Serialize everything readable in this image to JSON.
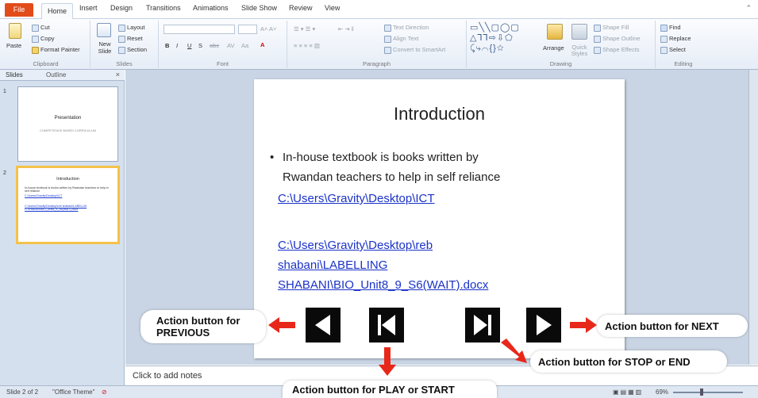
{
  "tabs": {
    "file": "File",
    "items": [
      "Home",
      "Insert",
      "Design",
      "Transitions",
      "Animations",
      "Slide Show",
      "Review",
      "View"
    ]
  },
  "ribbon": {
    "clipboard": {
      "label": "Clipboard",
      "paste": "Paste",
      "cut": "Cut",
      "copy": "Copy",
      "format_painter": "Format Painter"
    },
    "slides": {
      "label": "Slides",
      "new_slide": "New Slide",
      "layout": "Layout",
      "reset": "Reset",
      "section": "Section"
    },
    "font": {
      "label": "Font",
      "bold": "B",
      "italic": "I",
      "underline": "U",
      "strike": "S",
      "case": "Aa"
    },
    "paragraph": {
      "label": "Paragraph",
      "text_direction": "Text Direction",
      "align_text": "Align Text",
      "convert_smartart": "Convert to SmartArt"
    },
    "drawing": {
      "label": "Drawing",
      "arrange": "Arrange",
      "quick_styles": "Quick Styles",
      "shape_fill": "Shape Fill",
      "shape_outline": "Shape Outline",
      "shape_effects": "Shape Effects"
    },
    "editing": {
      "label": "Editing",
      "find": "Find",
      "replace": "Replace",
      "select": "Select"
    }
  },
  "left_pane": {
    "tab_slides": "Slides",
    "tab_outline": "Outline",
    "close": "×",
    "thumbnails": [
      {
        "number": "1",
        "title": "Presentation",
        "subtitle": "COMPETENCE BASED CURRICULUM"
      },
      {
        "number": "2",
        "title": "Introduction",
        "text": "In-house textbook is books written by Rwandan teachers to help in self reliance",
        "links": [
          "C:\\Users\\Gravity\\Desktop\\ICT",
          "C:\\Users\\Gravity\\Desktop\\reb shabani\\LABELLING SHABANI\\BIO_Unit8_9_S6(WAIT).docx"
        ]
      }
    ]
  },
  "slide": {
    "title": "Introduction",
    "bullet_line1": "In-house textbook is books written by",
    "bullet_line2": "Rwandan teachers to help in self reliance",
    "link1": "C:\\Users\\Gravity\\Desktop\\ICT",
    "link2_line1": "C:\\Users\\Gravity\\Desktop\\reb",
    "link2_line2": "shabani\\LABELLING",
    "link2_line3": "SHABANI\\BIO_Unit8_9_S6(WAIT).docx"
  },
  "annotations": {
    "previous_line1": "Action button for",
    "previous_line2": "PREVIOUS",
    "next": "Action button for NEXT",
    "stop": "Action button for STOP or END",
    "play": "Action button for PLAY or START"
  },
  "notes": {
    "placeholder": "Click to add notes"
  },
  "status": {
    "slide_info": "Slide 2 of 2",
    "theme": "\"Office Theme\"",
    "zoom": "69%"
  },
  "colors": {
    "accent": "#e24c1a",
    "link": "#1a32c8",
    "arrow": "#e8271b",
    "selection": "#f4c24a"
  }
}
